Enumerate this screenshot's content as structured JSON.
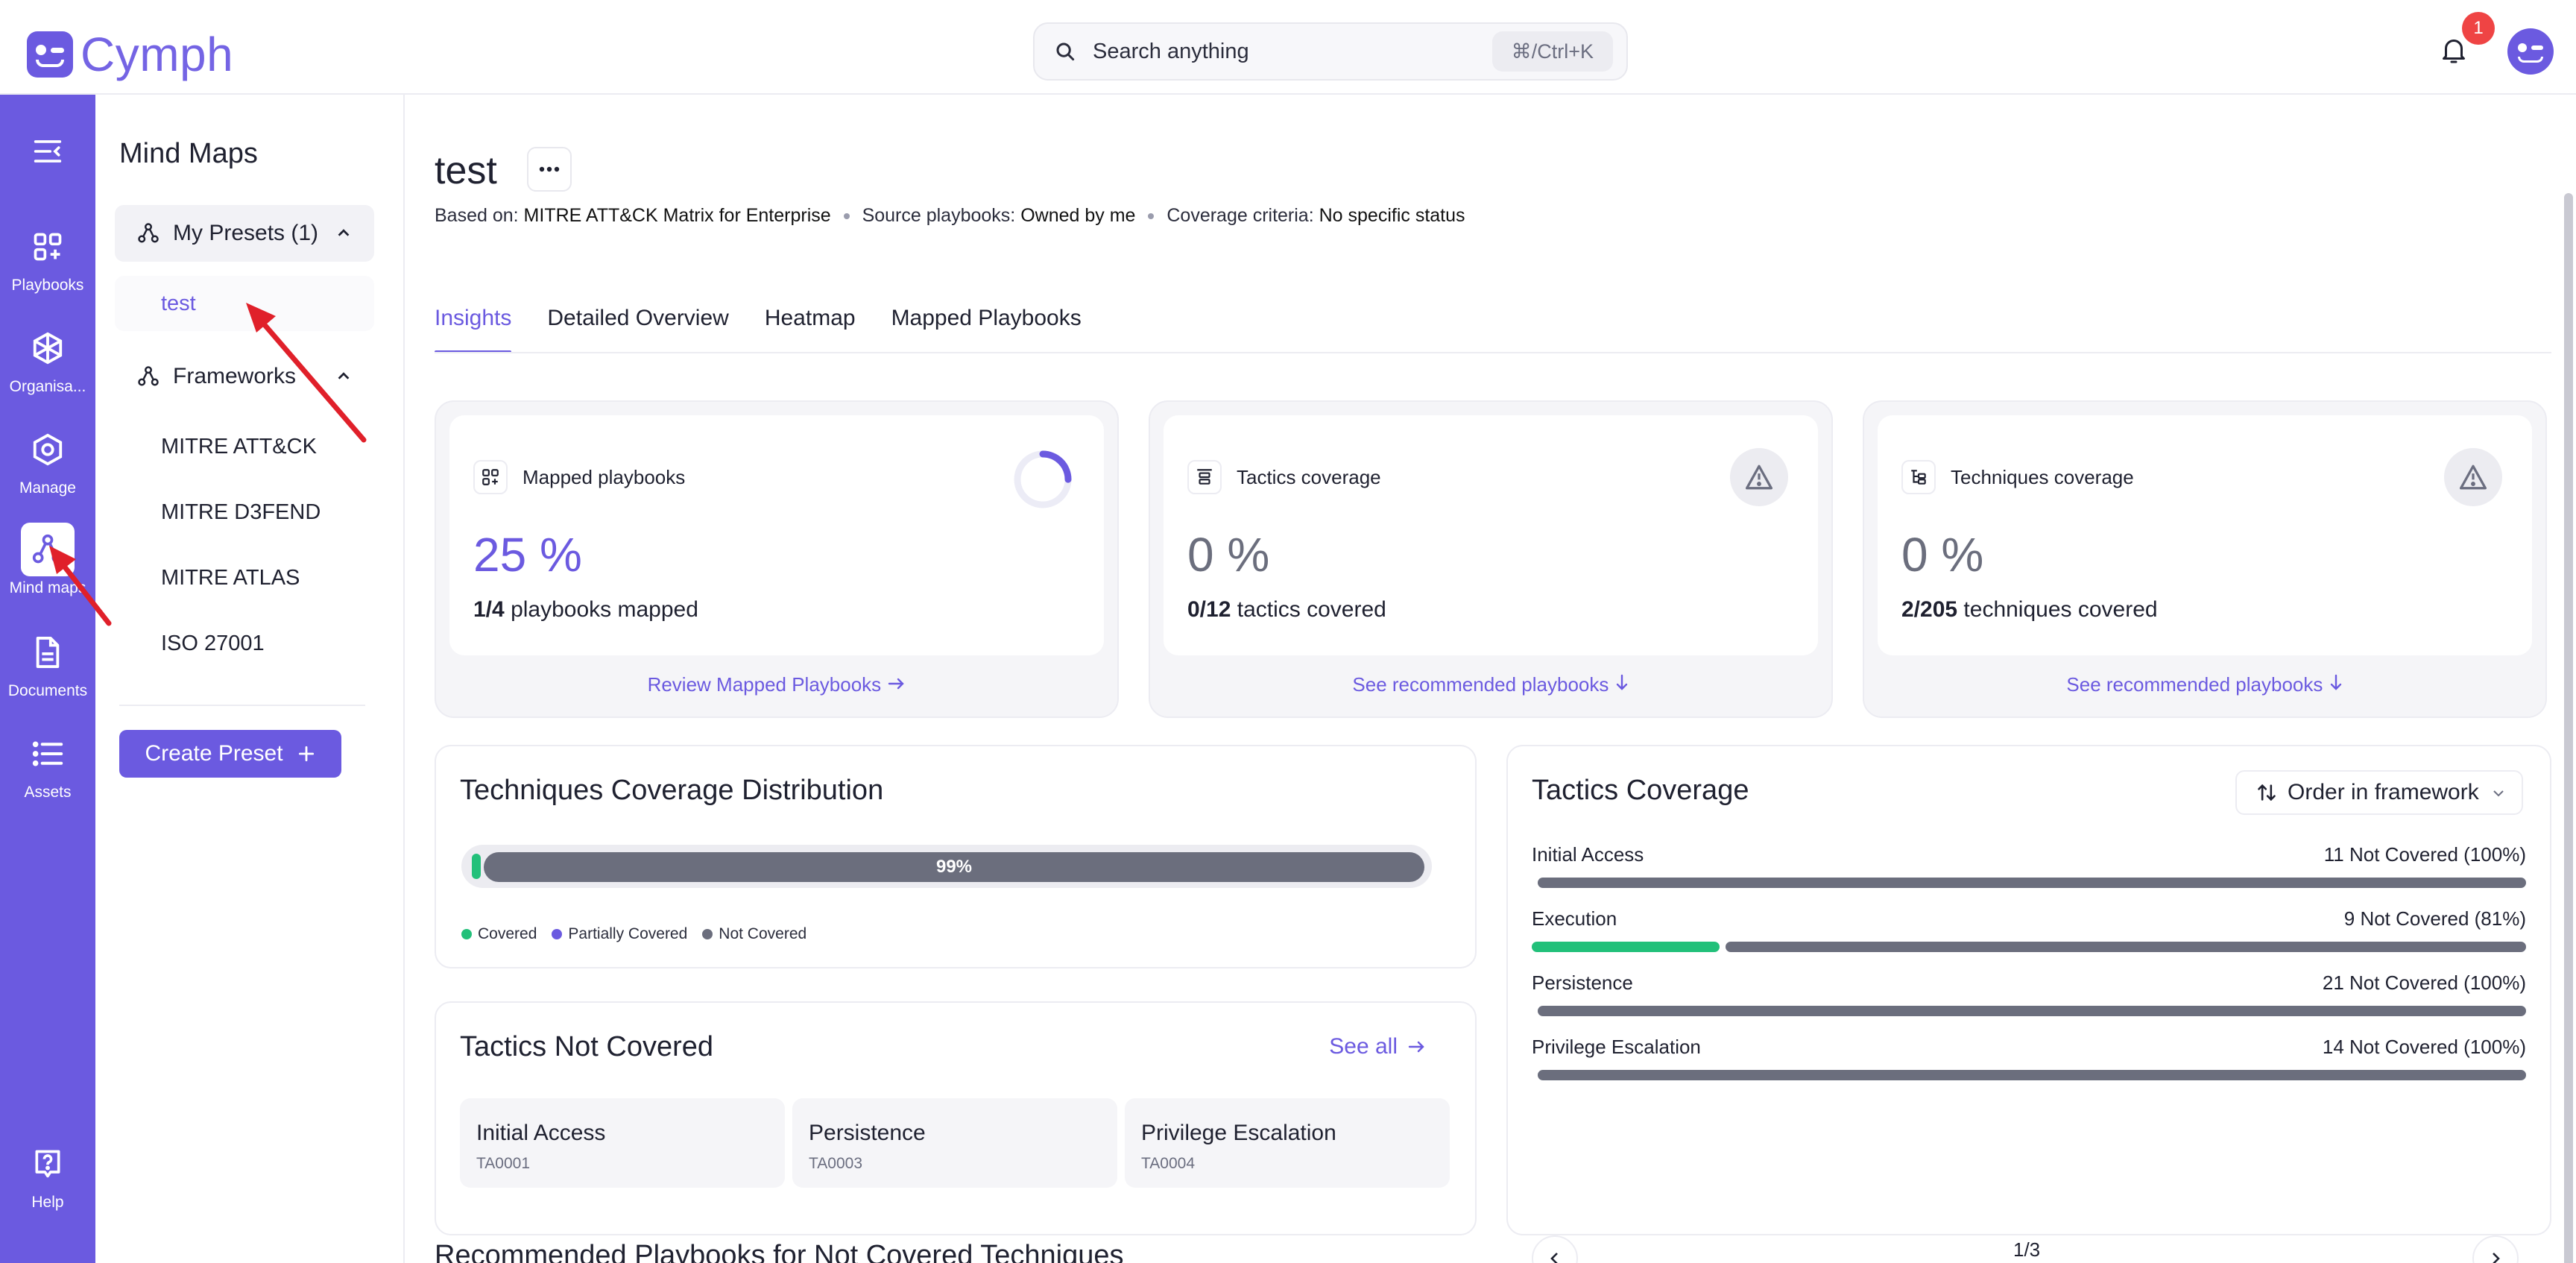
{
  "app": {
    "name": "Cymph"
  },
  "search": {
    "placeholder": "Search anything",
    "shortcut": "⌘/Ctrl+K"
  },
  "notifications": {
    "count": "1"
  },
  "rail": {
    "items": [
      {
        "label": "Playbooks",
        "icon": "grid-plus-icon"
      },
      {
        "label": "Organisa...",
        "icon": "hexagon-icon"
      },
      {
        "label": "Manage",
        "icon": "hex-settings-icon"
      },
      {
        "label": "Mind maps",
        "icon": "mindmap-icon",
        "active": true
      },
      {
        "label": "Documents",
        "icon": "document-icon"
      },
      {
        "label": "Assets",
        "icon": "list-icon"
      }
    ],
    "help": "Help"
  },
  "sidebar": {
    "title": "Mind Maps",
    "presets_label": "My Presets (1)",
    "presets": [
      "test"
    ],
    "frameworks_label": "Frameworks",
    "frameworks": [
      "MITRE ATT&CK",
      "MITRE D3FEND",
      "MITRE ATLAS",
      "ISO 27001"
    ],
    "create_label": "Create Preset"
  },
  "page": {
    "title": "test",
    "meta": {
      "based_on_label": "Based on:",
      "based_on": "MITRE ATT&CK Matrix for Enterprise",
      "source_label": "Source playbooks:",
      "source": "Owned by me",
      "criteria_label": "Coverage criteria:",
      "criteria": "No specific status"
    },
    "tabs": [
      "Insights",
      "Detailed Overview",
      "Heatmap",
      "Mapped Playbooks"
    ]
  },
  "cards": [
    {
      "label": "Mapped playbooks",
      "pct": "25 %",
      "count": "1/4",
      "desc": "playbooks mapped",
      "link": "Review Mapped Playbooks",
      "progress": 0.25
    },
    {
      "label": "Tactics coverage",
      "pct": "0 %",
      "count": "0/12",
      "desc": "tactics covered",
      "link": "See recommended playbooks"
    },
    {
      "label": "Techniques coverage",
      "pct": "0 %",
      "count": "2/205",
      "desc": "techniques covered",
      "link": "See recommended playbooks"
    }
  ],
  "distribution": {
    "title": "Techniques Coverage Distribution",
    "bar_label": "99%",
    "covered_fraction": 0.01,
    "legend": [
      "Covered",
      "Partially Covered",
      "Not Covered"
    ],
    "colors": {
      "covered": "#22c07a",
      "partial": "#6b5ae0",
      "not": "#6b6e7d"
    }
  },
  "tactics_not_covered": {
    "title": "Tactics Not Covered",
    "see_all": "See all",
    "items": [
      {
        "name": "Initial Access",
        "id": "TA0001"
      },
      {
        "name": "Persistence",
        "id": "TA0003"
      },
      {
        "name": "Privilege Escalation",
        "id": "TA0004"
      }
    ]
  },
  "tactics_coverage": {
    "title": "Tactics Coverage",
    "order_label": "Order in framework",
    "rows": [
      {
        "name": "Initial Access",
        "status": "11 Not Covered (100%)",
        "covered": 0
      },
      {
        "name": "Execution",
        "status": "9 Not Covered (81%)",
        "covered": 0.19
      },
      {
        "name": "Persistence",
        "status": "21 Not Covered (100%)",
        "covered": 0
      },
      {
        "name": "Privilege Escalation",
        "status": "14 Not Covered (100%)",
        "covered": 0
      }
    ],
    "page": "1/3"
  },
  "recommended_heading": "Recommended Playbooks for Not Covered Techniques",
  "colors": {
    "accent": "#6b5ae0",
    "green": "#22c07a",
    "gray": "#6b6e7d",
    "alert": "#ef4444"
  }
}
